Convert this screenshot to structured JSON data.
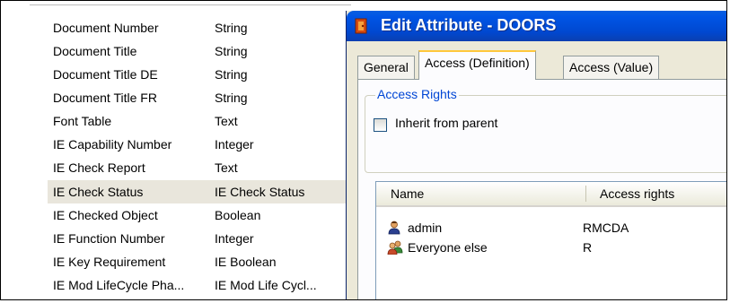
{
  "attributes": [
    {
      "name": "Document Number",
      "type": "String"
    },
    {
      "name": "Document Title",
      "type": "String"
    },
    {
      "name": "Document Title DE",
      "type": "String"
    },
    {
      "name": "Document Title FR",
      "type": "String"
    },
    {
      "name": "Font Table",
      "type": "Text"
    },
    {
      "name": "IE Capability Number",
      "type": "Integer"
    },
    {
      "name": "IE Check Report",
      "type": "Text"
    },
    {
      "name": "IE Check Status",
      "type": "IE Check Status"
    },
    {
      "name": "IE Checked Object",
      "type": "Boolean"
    },
    {
      "name": "IE Function Number",
      "type": "Integer"
    },
    {
      "name": "IE Key Requirement",
      "type": "IE Boolean"
    },
    {
      "name": "IE Mod LifeCycle Pha...",
      "type": "IE Mod Life Cycl..."
    }
  ],
  "dialog": {
    "title": "Edit Attribute - DOORS",
    "tabs": [
      "General",
      "Access (Definition)",
      "Access (Value)"
    ],
    "group_label": "Access Rights",
    "inherit_label": "Inherit from parent",
    "inherit_checked": false,
    "list_headers": {
      "name": "Name",
      "rights": "Access rights"
    },
    "users": [
      {
        "name": "admin",
        "rights": "RMCDA",
        "icon": "user-icon"
      },
      {
        "name": "Everyone else",
        "rights": "R",
        "icon": "group-icon"
      }
    ]
  },
  "colors": {
    "titlebar": "#0055e5",
    "selected_row": "#e9e6dc",
    "group_label": "#0046d5",
    "active_tab_accent": "#ffc83c"
  }
}
